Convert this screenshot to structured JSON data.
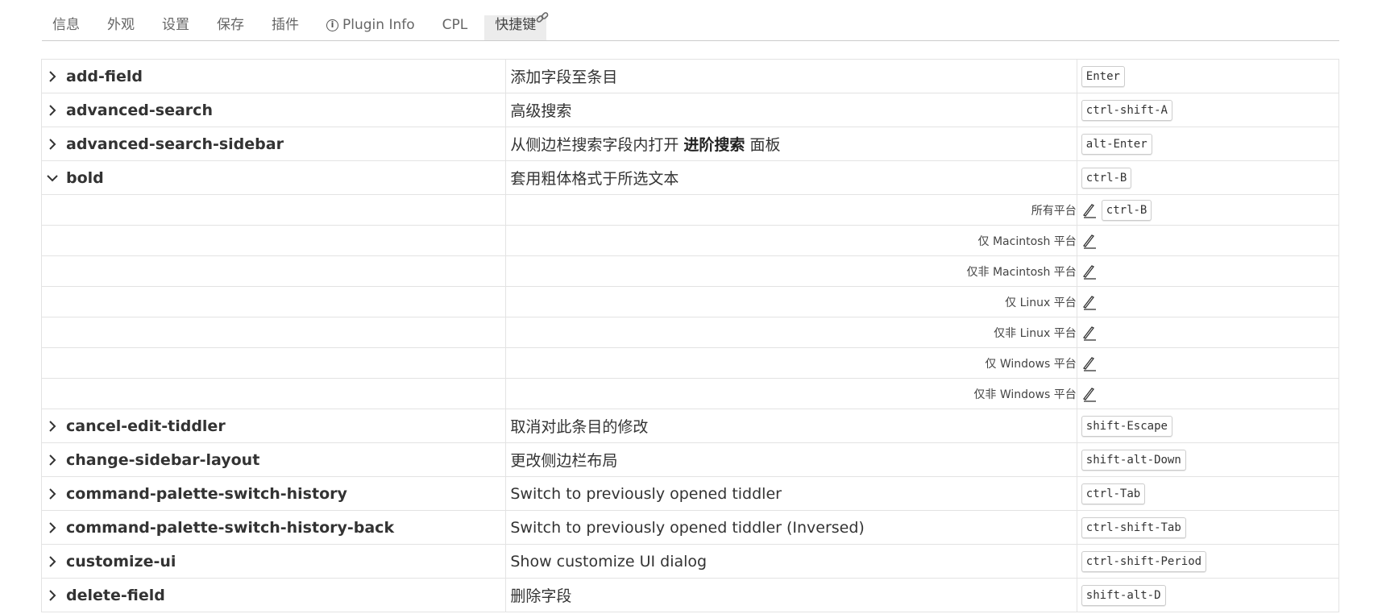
{
  "tabs": [
    {
      "label": "信息",
      "active": false
    },
    {
      "label": "外观",
      "active": false
    },
    {
      "label": "设置",
      "active": false
    },
    {
      "label": "保存",
      "active": false
    },
    {
      "label": "插件",
      "active": false
    },
    {
      "label": "Plugin Info",
      "active": false,
      "icon": "info-icon"
    },
    {
      "label": "CPL",
      "active": false
    },
    {
      "label": "快捷键",
      "active": true,
      "icon": "link-icon"
    }
  ],
  "shortcuts": [
    {
      "name": "add-field",
      "desc": "添加字段至条目",
      "key": "Enter",
      "expanded": false
    },
    {
      "name": "advanced-search",
      "desc": "高级搜索",
      "key": "ctrl-shift-A",
      "expanded": false
    },
    {
      "name": "advanced-search-sidebar",
      "desc_pre": "从侧边栏搜索字段内打开 ",
      "desc_bold": "进阶搜索",
      "desc_post": " 面板",
      "key": "alt-Enter",
      "expanded": false
    },
    {
      "name": "bold",
      "desc": "套用粗体格式于所选文本",
      "key": "ctrl-B",
      "expanded": true
    }
  ],
  "bold_platforms": [
    {
      "label": "所有平台",
      "key": "ctrl-B"
    },
    {
      "label": "仅 Macintosh 平台",
      "key": ""
    },
    {
      "label": "仅非 Macintosh 平台",
      "key": ""
    },
    {
      "label": "仅 Linux 平台",
      "key": ""
    },
    {
      "label": "仅非 Linux 平台",
      "key": ""
    },
    {
      "label": "仅 Windows 平台",
      "key": ""
    },
    {
      "label": "仅非 Windows 平台",
      "key": ""
    }
  ],
  "shortcuts_after": [
    {
      "name": "cancel-edit-tiddler",
      "desc": "取消对此条目的修改",
      "key": "shift-Escape"
    },
    {
      "name": "change-sidebar-layout",
      "desc": "更改侧边栏布局",
      "key": "shift-alt-Down"
    },
    {
      "name": "command-palette-switch-history",
      "desc": "Switch to previously opened tiddler",
      "key": "ctrl-Tab"
    },
    {
      "name": "command-palette-switch-history-back",
      "desc": "Switch to previously opened tiddler (Inversed)",
      "key": "ctrl-shift-Tab"
    },
    {
      "name": "customize-ui",
      "desc": "Show customize UI dialog",
      "key": "ctrl-shift-Period"
    },
    {
      "name": "delete-field",
      "desc": "删除字段",
      "key": "shift-alt-D"
    }
  ]
}
